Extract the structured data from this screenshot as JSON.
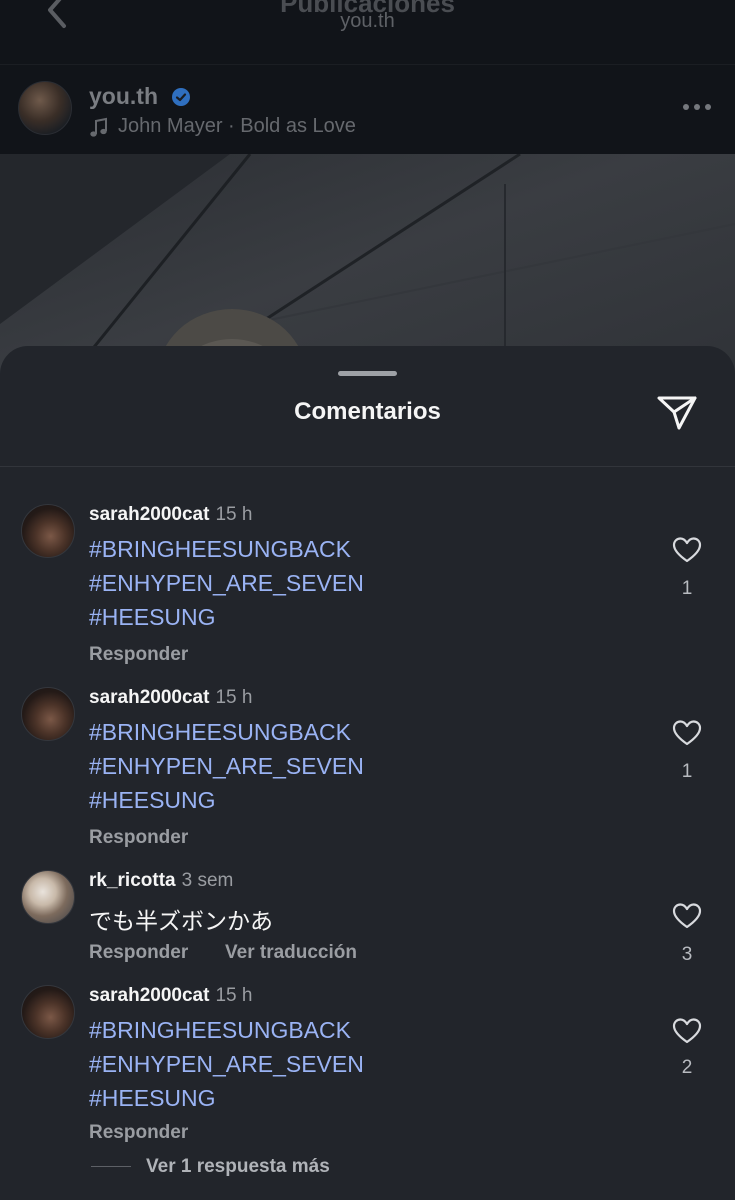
{
  "topbar": {
    "title": "Publicaciones",
    "subtitle": "you.th"
  },
  "post": {
    "username": "you.th",
    "audio": "John Mayer · Bold as Love"
  },
  "sheet": {
    "title": "Comentarios"
  },
  "comments": [
    {
      "user": "sarah2000cat",
      "time": "15 h",
      "lines": [
        "#BRINGHEESUNGBACK",
        "#ENHYPEN_ARE_SEVEN",
        "#HEESUNG"
      ],
      "reply": "Responder",
      "likes": "1"
    },
    {
      "user": "sarah2000cat",
      "time": "15 h",
      "lines": [
        "#BRINGHEESUNGBACK",
        "#ENHYPEN_ARE_SEVEN",
        "#HEESUNG"
      ],
      "reply": "Responder",
      "likes": "1"
    },
    {
      "user": "rk_ricotta",
      "time": "3 sem",
      "lines": [
        "でも半ズボンかあ"
      ],
      "reply": "Responder",
      "translate": "Ver traducción",
      "likes": "3"
    },
    {
      "user": "sarah2000cat",
      "time": "15 h",
      "lines": [
        "#BRINGHEESUNGBACK",
        "#ENHYPEN_ARE_SEVEN",
        "#HEESUNG"
      ],
      "reply": "Responder",
      "likes": "2",
      "view_replies": "Ver 1 respuesta más"
    }
  ],
  "colors": {
    "hashtag": "#9ab3f4",
    "sheet_bg": "#22252b",
    "verified": "#3b8ef0"
  },
  "icons": [
    "back-icon",
    "verified-icon",
    "music-icon",
    "more-icon",
    "share-icon",
    "heart-icon"
  ]
}
